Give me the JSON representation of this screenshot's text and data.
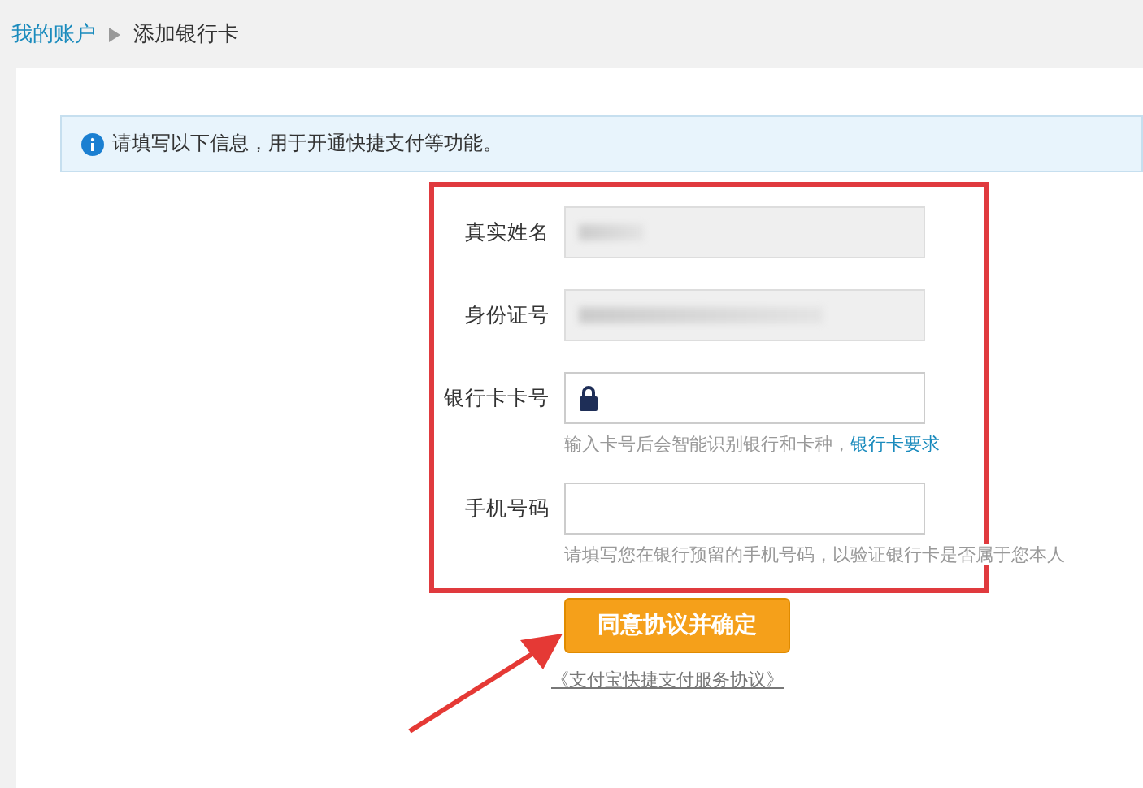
{
  "breadcrumb": {
    "parent": "我的账户",
    "current": "添加银行卡"
  },
  "notice": "请填写以下信息，用于开通快捷支付等功能。",
  "fields": [
    {
      "label": "真实姓名",
      "kind": "blurred",
      "disabled": true,
      "lock": false
    },
    {
      "label": "身份证号",
      "kind": "blurred",
      "disabled": true,
      "lock": false
    },
    {
      "label": "银行卡卡号",
      "kind": "input",
      "disabled": false,
      "lock": true,
      "hint": "输入卡号后会智能识别银行和卡种，",
      "hint_link": "银行卡要求"
    },
    {
      "label": "手机号码",
      "kind": "input",
      "disabled": false,
      "lock": false,
      "hint": "请填写您在银行预留的手机号码，以验证银行卡是否属于您本人"
    }
  ],
  "submit": "同意协议并确定",
  "agreement_link": "《支付宝快捷支付服务协议》"
}
